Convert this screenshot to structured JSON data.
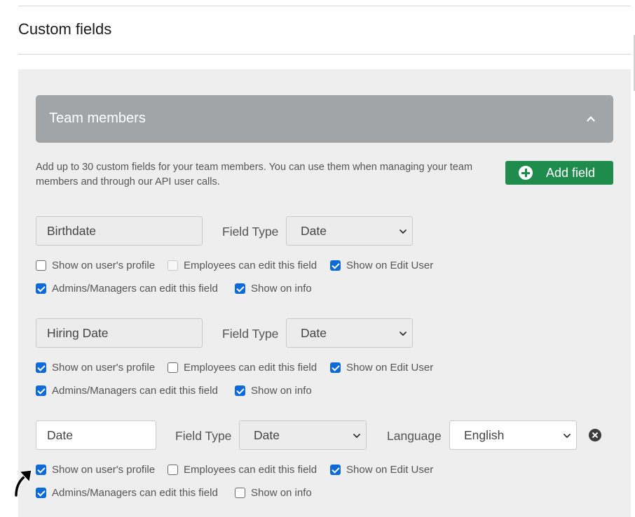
{
  "page": {
    "title": "Custom fields"
  },
  "card": {
    "title": "Team members",
    "description": "Add up to 30 custom fields for your team members. You can use them when managing your team members and through our API user calls.",
    "add_button_label": "Add field"
  },
  "labels": {
    "field_type": "Field Type",
    "language": "Language",
    "show_profile": "Show on user's profile",
    "employees_edit": "Employees can edit this field",
    "show_edit_user": "Show on Edit User",
    "admins_edit": "Admins/Managers can edit this field",
    "show_info": "Show on info"
  },
  "fields": [
    {
      "name": "Birthdate",
      "type": "Date",
      "show_profile": false,
      "employees_edit": false,
      "employees_edit_disabled": true,
      "show_edit_user": true,
      "admins_edit": true,
      "show_info": true
    },
    {
      "name": "Hiring Date",
      "type": "Date",
      "show_profile": true,
      "employees_edit": false,
      "employees_edit_disabled": false,
      "show_edit_user": true,
      "admins_edit": true,
      "show_info": true
    },
    {
      "name": "Date",
      "type": "Date",
      "language": "English",
      "show_profile": true,
      "employees_edit": false,
      "employees_edit_disabled": false,
      "show_edit_user": true,
      "admins_edit": true,
      "show_info": false
    }
  ],
  "colors": {
    "accent_green": "#1f8b4c",
    "checkbox_blue": "#0d6ad8",
    "header_gray": "#a2a5a8"
  },
  "icons": {
    "collapse": "chevron-up-icon",
    "add": "plus-circle-icon",
    "remove": "close-circle-icon",
    "cursor": "arrow-cursor-icon"
  }
}
